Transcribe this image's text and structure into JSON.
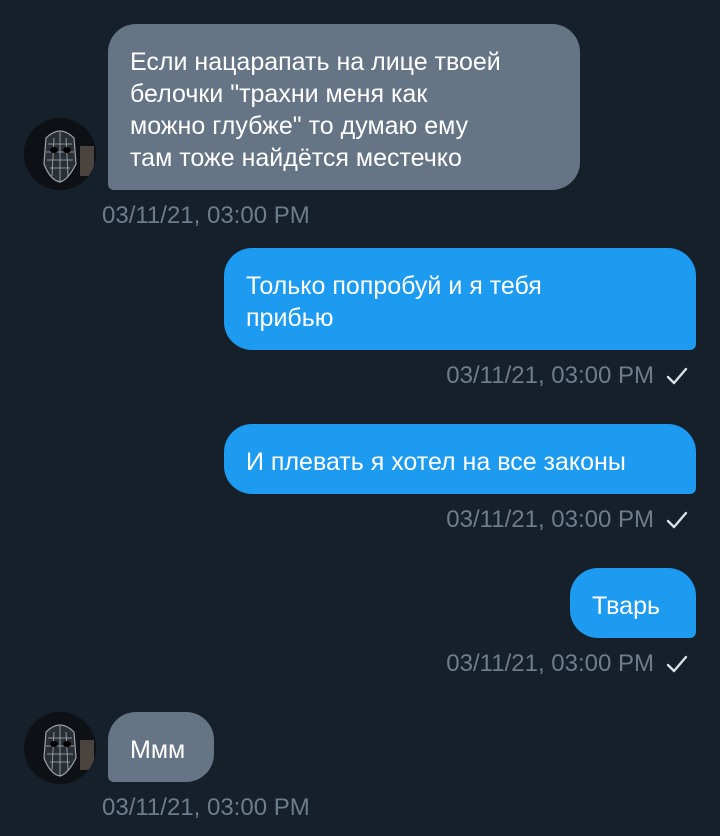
{
  "messages": [
    {
      "direction": "in",
      "text": "Если нацарапать на лице твоей\nбелочки \"трахни меня как\nможно глубже\" то думаю ему\nтам тоже найдётся местечко",
      "timestamp": "03/11/21, 03:00 PM",
      "read": false
    },
    {
      "direction": "out",
      "text": "Только попробуй и я тебя\nприбью",
      "timestamp": "03/11/21, 03:00 PM",
      "read": true
    },
    {
      "direction": "out",
      "text": "И плевать я хотел на все законы",
      "timestamp": "03/11/21, 03:00 PM",
      "read": true
    },
    {
      "direction": "out",
      "text": "Тварь",
      "timestamp": "03/11/21, 03:00 PM",
      "read": true
    },
    {
      "direction": "in",
      "text": "Ммм",
      "timestamp": "03/11/21, 03:00 PM",
      "read": false
    }
  ],
  "colors": {
    "background": "#15202b",
    "incoming_bubble": "#657585",
    "outgoing_bubble": "#1d9bf0",
    "timestamp": "#6e7d8c"
  },
  "icons": {
    "read_receipt": "checkmark-icon",
    "avatar": "masked-figure-avatar"
  }
}
